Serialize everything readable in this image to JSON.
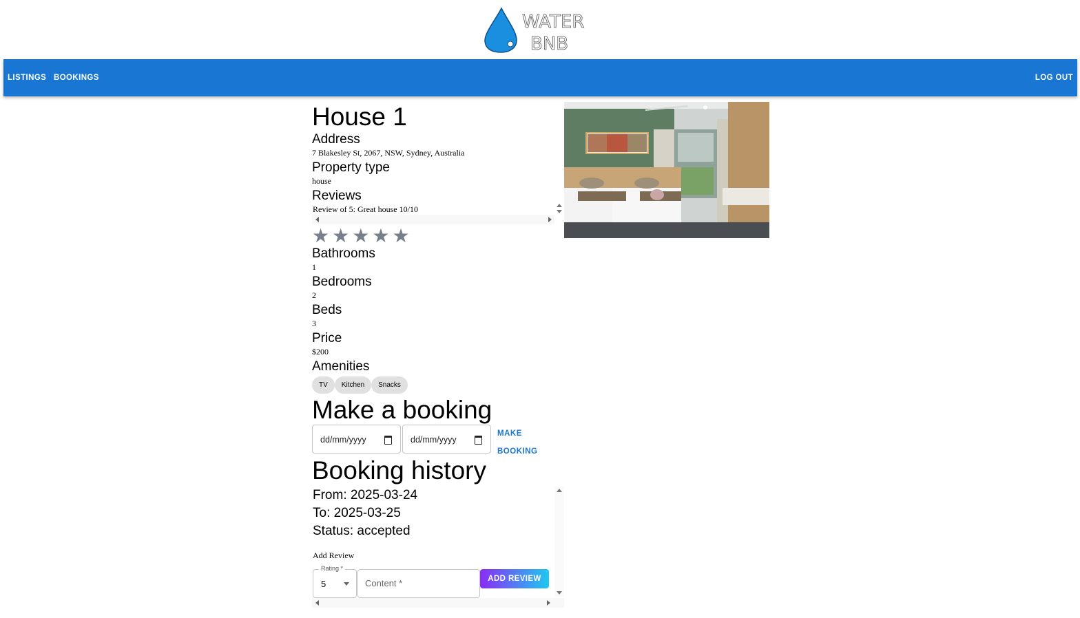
{
  "logo": {
    "line1": "WATER",
    "line2": "BNB"
  },
  "nav": {
    "listings": "LISTINGS",
    "bookings": "BOOKINGS",
    "logout": "LOG OUT"
  },
  "listing": {
    "title": "House 1",
    "address_label": "Address",
    "address": "7 Blakesley St, 2067, NSW, Sydney, Australia",
    "property_type_label": "Property type",
    "property_type": "house",
    "reviews_label": "Reviews",
    "reviews": [
      "Review of 5: Great house 10/10"
    ],
    "rating_stars": 5,
    "star_glyph": "★",
    "bathrooms_label": "Bathrooms",
    "bathrooms": "1",
    "bedrooms_label": "Bedrooms",
    "bedrooms": "2",
    "beds_label": "Beds",
    "beds": "3",
    "price_label": "Price",
    "price": "$200",
    "amenities_label": "Amenities",
    "amenities": [
      "TV",
      "Kitchen",
      "Snacks"
    ]
  },
  "booking": {
    "heading": "Make a booking",
    "start_placeholder": "dd/mm/yyyy",
    "end_placeholder": "dd/mm/yyyy",
    "make_booking_label": "MAKE BOOKING"
  },
  "history": {
    "heading": "Booking history",
    "from": "From: 2025-03-24",
    "to": "To: 2025-03-25",
    "status": "Status: accepted",
    "add_review_label": "Add Review",
    "rating_label": "Rating *",
    "rating_value": "5",
    "content_placeholder": "Content *",
    "add_review_button": "ADD REVIEW"
  },
  "colors": {
    "appbar": "#1976d2",
    "star": "#77808a",
    "chip": "#e0e0e0",
    "drop": "#1a8fe0"
  },
  "icons": {
    "logo": "water-drop-icon",
    "calendar": "calendar-icon",
    "star": "star-icon",
    "caret": "caret-down-icon"
  }
}
